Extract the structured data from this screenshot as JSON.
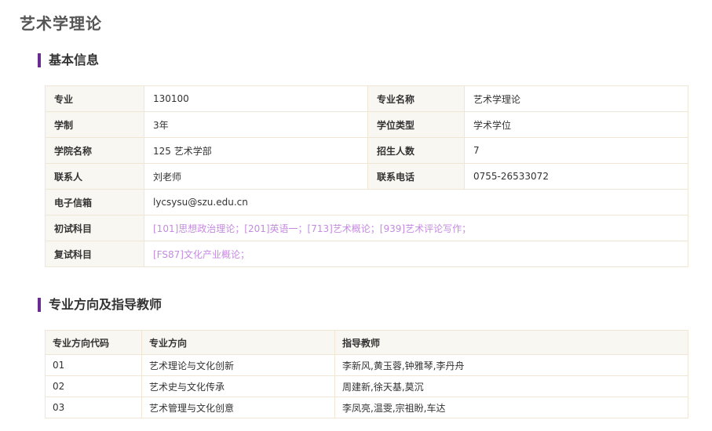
{
  "page": {
    "title": "艺术学理论"
  },
  "basic_info": {
    "heading": "基本信息",
    "rows": [
      [
        {
          "label": "专业",
          "value": "130100"
        },
        {
          "label": "专业名称",
          "value": "艺术学理论"
        }
      ],
      [
        {
          "label": "学制",
          "value": "3年"
        },
        {
          "label": "学位类型",
          "value": "学术学位"
        }
      ],
      [
        {
          "label": "学院名称",
          "value": "125 艺术学部"
        },
        {
          "label": "招生人数",
          "value": "7"
        }
      ],
      [
        {
          "label": "联系人",
          "value": "刘老师"
        },
        {
          "label": "联系电话",
          "value": "0755-26533072"
        }
      ]
    ],
    "email": {
      "label": "电子信箱",
      "value": "lycsysu@szu.edu.cn"
    },
    "initial_exam": {
      "label": "初试科目",
      "value": "[101]思想政治理论；[201]英语一；[713]艺术概论；[939]艺术评论写作；"
    },
    "retest_exam": {
      "label": "复试科目",
      "value": "[FS87]文化产业概论；"
    }
  },
  "directions": {
    "heading": "专业方向及指导教师",
    "columns": [
      "专业方向代码",
      "专业方向",
      "指导教师"
    ],
    "rows": [
      [
        "01",
        "艺术理论与文化创新",
        "李新风,黄玉蓉,钟雅琴,李丹舟"
      ],
      [
        "02",
        "艺术史与文化传承",
        "周建新,徐天基,莫沉"
      ],
      [
        "03",
        "艺术管理与文化创意",
        "李凤亮,温雯,宗祖盼,车达"
      ]
    ]
  },
  "colors": {
    "accent_bar": "#6a2c91",
    "link_purple": "#c58be0",
    "label_bg": "#f9f7f2",
    "border": "#efe6d6"
  }
}
